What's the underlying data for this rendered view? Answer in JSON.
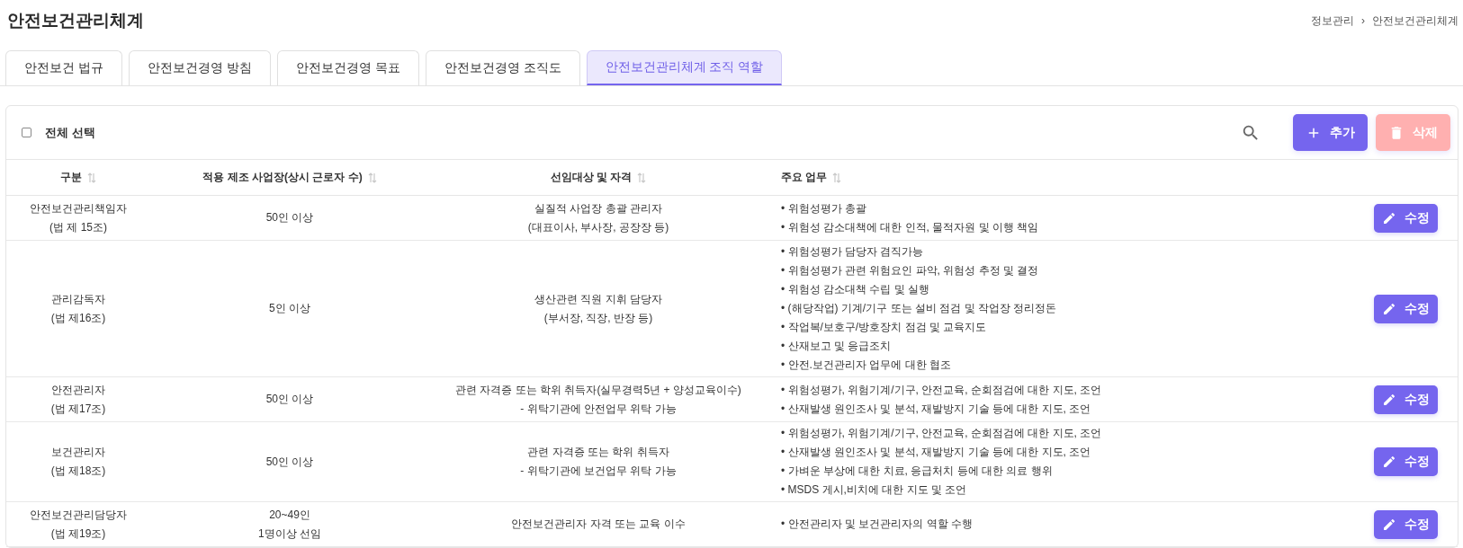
{
  "page": {
    "title": "안전보건관리체계"
  },
  "breadcrumb": {
    "items": [
      "정보관리",
      "안전보건관리체계"
    ],
    "separator": "›"
  },
  "tabs": [
    {
      "label": "안전보건 법규",
      "selected": false
    },
    {
      "label": "안전보건경영 방침",
      "selected": false
    },
    {
      "label": "안전보건경영 목표",
      "selected": false
    },
    {
      "label": "안전보건경영 조직도",
      "selected": false
    },
    {
      "label": "안전보건관리체계 조직 역할",
      "selected": true
    }
  ],
  "toolbar": {
    "select_all": {
      "label": "전체 선택",
      "checked": false
    },
    "buttons": [
      {
        "kind": "add",
        "label": "추가",
        "disabled": false
      },
      {
        "kind": "delete",
        "label": "삭제",
        "disabled": true
      }
    ]
  },
  "table": {
    "columns": [
      "구분",
      "적용 제조 사업장(상시 근로자 수)",
      "선임대상 및 자격",
      "주요 업무"
    ],
    "rows": [
      {
        "role": "안전보건관리책임자\n(법 제 15조)",
        "workplace": "50인 이상",
        "qualification": "실질적 사업장 총괄 관리자\n(대표이사, 부사장, 공장장 등)",
        "duties": [
          "• 위험성평가 총괄",
          "• 위험성 감소대책에 대한 인적, 물적자원 및 이행 책임"
        ],
        "action": "수정"
      },
      {
        "role": "관리감독자\n(법 제16조)",
        "workplace": "5인 이상",
        "qualification": "생산관련 직원 지휘 담당자\n(부서장, 직장, 반장 등)",
        "duties": [
          "• 위험성평가 담당자 겸직가능",
          "• 위험성평가 관련 위험요인 파악, 위험성 추정 및 결정",
          "• 위험성 감소대책 수립 및 실행",
          "• (해당작업) 기계/기구 또는 설비 점검 및 작업장 정리정돈",
          "• 작업복/보호구/방호장치 점검 및 교육지도",
          "• 산재보고 및 응급조치",
          "• 안전.보건관리자 업무에 대한 협조"
        ],
        "action": "수정"
      },
      {
        "role": "안전관리자\n(법 제17조)",
        "workplace": "50인 이상",
        "qualification": "관련 자격증 또는 학위 취득자(실무경력5년 + 양성교육이수)\n- 위탁기관에 안전업무 위탁 가능",
        "duties": [
          "• 위험성평가, 위험기계/기구, 안전교육, 순회점검에 대한 지도, 조언",
          "• 산재발생 원인조사 및 분석, 재발방지 기술 등에 대한 지도, 조언"
        ],
        "action": "수정"
      },
      {
        "role": "보건관리자\n(법 제18조)",
        "workplace": "50인 이상",
        "qualification": "관련 자격증 또는 학위 취득자\n- 위탁기관에 보건업무 위탁 가능",
        "duties": [
          "• 위험성평가, 위험기계/기구, 안전교육, 순회점검에 대한 지도, 조언",
          "• 산재발생 원인조사 및 분석, 재발방지 기술 등에 대한 지도, 조언",
          "• 가벼운 부상에 대한 치료, 응급처치 등에 대한 의료 행위",
          "• MSDS 게시,비치에 대한 지도 및 조언"
        ],
        "action": "수정"
      },
      {
        "role": "안전보건관리담당자\n(법 제19조)",
        "workplace": "20~49인\n1명이상 선임",
        "qualification": "안전보건관리자 자격 또는 교육 이수",
        "duties": [
          "• 안전관리자 및 보건관리자의 역할 수행"
        ],
        "action": "수정"
      }
    ]
  }
}
